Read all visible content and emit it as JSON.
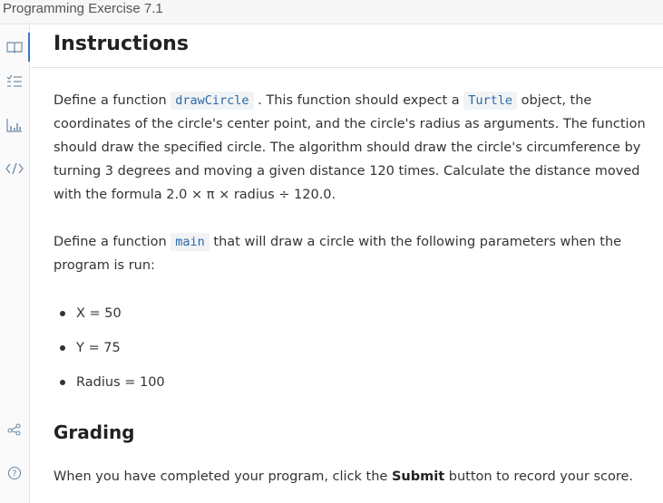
{
  "header": {
    "title": "Programming Exercise 7.1"
  },
  "sidebar": {
    "items": [
      {
        "icon": "book-icon",
        "active": true
      },
      {
        "icon": "list-icon",
        "active": false
      },
      {
        "icon": "bar-chart-icon",
        "active": false
      },
      {
        "icon": "code-icon",
        "active": false
      },
      {
        "icon": "share-icon",
        "active": false
      },
      {
        "icon": "help-icon",
        "active": false
      }
    ],
    "accent_color": "#3a75c4",
    "icon_color": "#6f8aa6"
  },
  "instructions": {
    "heading": "Instructions",
    "p1": {
      "t1": "Define a function ",
      "c1": "drawCircle",
      "t2": " . This function should expect a ",
      "c2": "Turtle",
      "t3": " object, the coordinates of the circle's center point, and the circle's radius as arguments. The function should draw the specified circle. The algorithm should draw the circle's circumference by turning 3 degrees and moving a given distance 120 times. Calculate the distance moved with the formula 2.0 × π × radius ÷ 120.0."
    },
    "p2": {
      "t1": "Define a function ",
      "c1": "main",
      "t2": " that will draw a circle with the following parameters when the program is run:"
    },
    "params": [
      "X = 50",
      "Y = 75",
      "Radius = 100"
    ]
  },
  "grading": {
    "heading": "Grading",
    "t1": "When you have completed your program, click the ",
    "bold": "Submit",
    "t2": " button to record your score."
  }
}
